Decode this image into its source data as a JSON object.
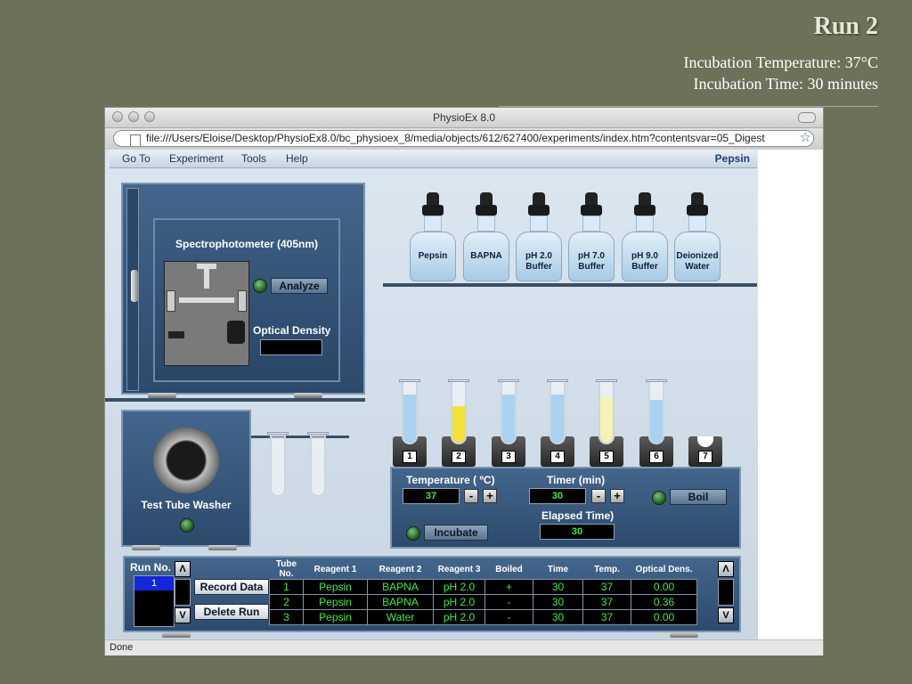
{
  "slide": {
    "title": "Run 2",
    "line1": "Incubation Temperature: 37°C",
    "line2": "Incubation Time: 30 minutes"
  },
  "window": {
    "title": "PhysioEx 8.0",
    "url": "file:///Users/Eloise/Desktop/PhysioEx8.0/bc_physioex_8/media/objects/612/627400/experiments/index.htm?contentsvar=05_Digest",
    "status": "Done"
  },
  "menu": {
    "items": [
      "Go To",
      "Experiment",
      "Tools",
      "Help"
    ],
    "right_label": "Pepsin"
  },
  "spectro": {
    "title": "Spectrophotometer (405nm)",
    "analyze_label": "Analyze",
    "od_label": "Optical Density",
    "od_value": ""
  },
  "bottles": [
    {
      "line1": "Pepsin",
      "line2": ""
    },
    {
      "line1": "BAPNA",
      "line2": ""
    },
    {
      "line1": "pH 2.0",
      "line2": "Buffer"
    },
    {
      "line1": "pH 7.0",
      "line2": "Buffer"
    },
    {
      "line1": "pH 9.0",
      "line2": "Buffer"
    },
    {
      "line1": "Deionized",
      "line2": "Water"
    }
  ],
  "washer": {
    "label": "Test Tube Washer"
  },
  "tubes": [
    {
      "number": "1",
      "fill_color": "#a9d2f2",
      "fill_level": 0.8
    },
    {
      "number": "2",
      "fill_color": "#f2e23a",
      "fill_level": 0.6
    },
    {
      "number": "3",
      "fill_color": "#a9d2f2",
      "fill_level": 0.8
    },
    {
      "number": "4",
      "fill_color": "#a9d2f2",
      "fill_level": 0.8
    },
    {
      "number": "5",
      "fill_color": "#f4f2b4",
      "fill_level": 0.75
    },
    {
      "number": "6",
      "fill_color": "#a9d2f2",
      "fill_level": 0.7
    },
    {
      "number": "7",
      "fill_color": "",
      "fill_level": 0
    }
  ],
  "controls": {
    "temperature_label": "Temperature ( ºC)",
    "temperature_value": "37",
    "timer_label": "Timer (min)",
    "timer_value": "30",
    "elapsed_label": "Elapsed Time)",
    "elapsed_value": "30",
    "incubate_label": "Incubate",
    "boil_label": "Boil",
    "minus": "-",
    "plus": "+"
  },
  "records": {
    "run_label": "Run No.",
    "run_value": "1",
    "record_label": "Record Data",
    "delete_label": "Delete Run",
    "up": "Λ",
    "down": "V",
    "headers": [
      "Tube No.",
      "Reagent 1",
      "Reagent 2",
      "Reagent 3",
      "Boiled",
      "Time",
      "Temp.",
      "Optical Dens."
    ],
    "rows": [
      [
        "1",
        "Pepsin",
        "BAPNA",
        "pH 2.0",
        "+",
        "30",
        "37",
        "0.00"
      ],
      [
        "2",
        "Pepsin",
        "BAPNA",
        "pH 2.0",
        "-",
        "30",
        "37",
        "0.36"
      ],
      [
        "3",
        "Pepsin",
        "Water",
        "pH 2.0",
        "-",
        "30",
        "37",
        "0.00"
      ]
    ]
  },
  "colors": {
    "slide_bg": "#6b7259",
    "panel_blue": "#3b5d82",
    "lcd_green": "#3dea3d"
  }
}
